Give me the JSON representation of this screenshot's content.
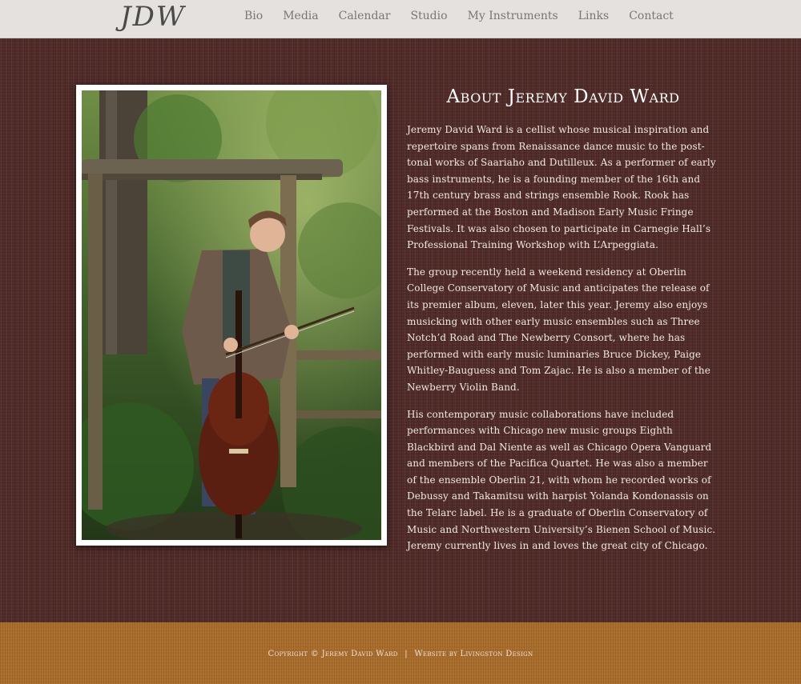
{
  "header": {
    "logo": "JDW",
    "nav": [
      "Bio",
      "Media",
      "Calendar",
      "Studio",
      "My Instruments",
      "Links",
      "Contact"
    ]
  },
  "main": {
    "title": "About Jeremy David Ward",
    "paragraphs": [
      "Jeremy David Ward is a cellist whose musical inspiration and repertoire spans from Renaissance dance music to the post-tonal works of Saariaho and Dutilleux. As a performer of early bass instruments, he is a founding member of the 16th and 17th century brass and strings ensemble Rook. Rook has performed at the Boston and Madison Early Music Fringe Festivals. It was also chosen to participate in Carnegie Hall’s Professional Training Workshop with L’Arpeggiata.",
      "The group recently held a weekend residency at Oberlin College Conservatory of Music and anticipates the release of its premier album, eleven, later this year. Jeremy also enjoys musicking with other early music ensembles such as Three Notch’d Road and The Newberry Consort, where he has performed with early music luminaries Bruce Dickey, Paige Whitley-Bauguess and Tom Zajac. He is also a member of the Newberry Violin Band.",
      "His contemporary music collaborations have included performances with Chicago new music groups Eighth Blackbird and Dal Niente as well as Chicago Opera Vanguard and members of the Pacifica Quartet. He was also a member of the ensemble Oberlin 21, with whom he recorded works of Debussy and Takamitsu with harpist Yolanda Kondonassis on the Telarc label. He is a graduate of Oberlin Conservatory of Music and Northwestern University’s Bienen School of Music. Jeremy currently lives in and loves the great city of Chicago."
    ]
  },
  "footer": {
    "copyright": "Copyright © Jeremy David Ward",
    "separator": "|",
    "credit": "Website by Livingston Design"
  },
  "colors": {
    "header_bg": "#e4e1de",
    "main_bg": "#4f2a27",
    "footer_bg": "#a86c2b",
    "text": "#f0e9e2"
  }
}
